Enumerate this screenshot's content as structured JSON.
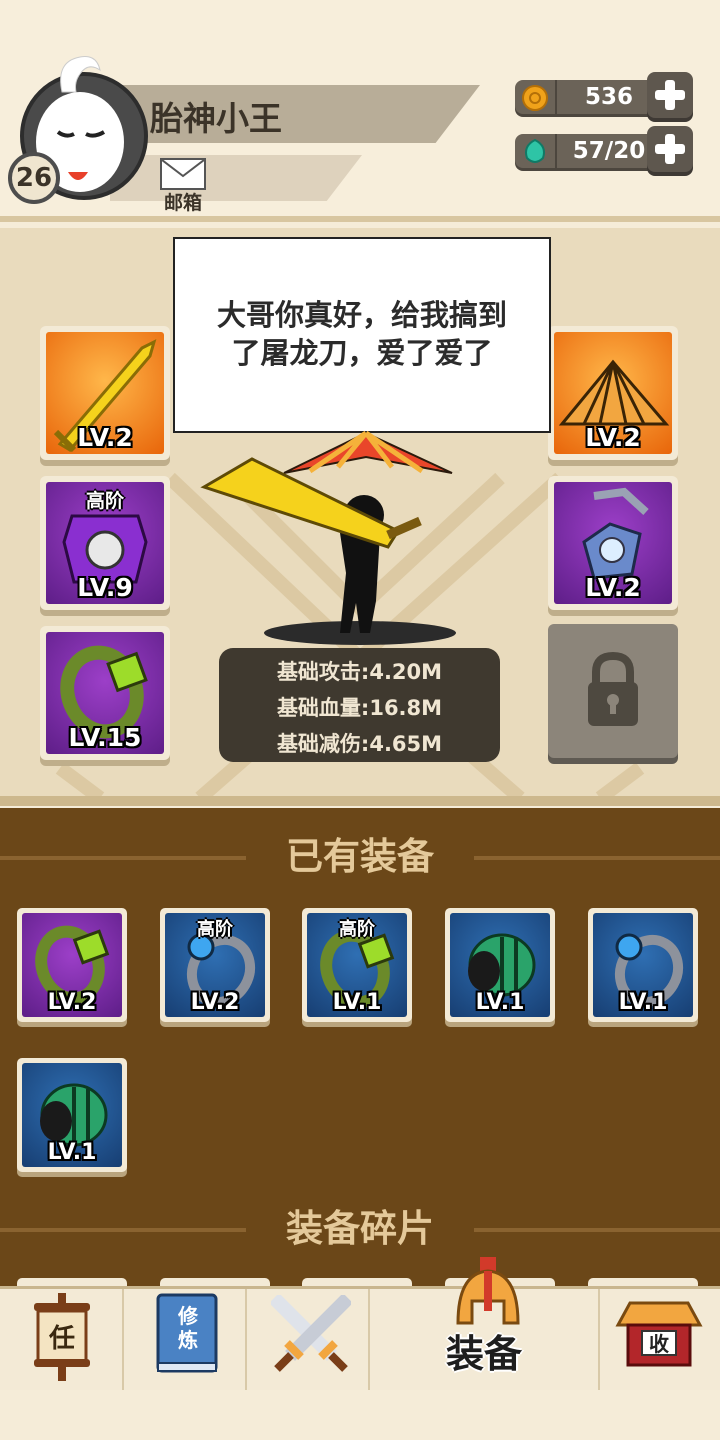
{
  "player": {
    "name": "胎神小王",
    "level": "26",
    "mail_label": "邮箱"
  },
  "resources": {
    "coins": {
      "value": "536",
      "icon": "coin-icon",
      "color": "#f0a21a"
    },
    "gems": {
      "value": "57/20",
      "icon": "gem-icon",
      "color": "#2ec4a6"
    }
  },
  "speech": {
    "text": "大哥你真好，给我搞到了屠龙刀，爱了爱了"
  },
  "equipped": {
    "left": [
      {
        "item": "sword-icon",
        "tier": "",
        "level": "LV.2",
        "bg": "orange"
      },
      {
        "item": "armor-icon",
        "tier": "高阶",
        "level": "LV.9",
        "bg": "purple"
      },
      {
        "item": "ring-icon",
        "tier": "",
        "level": "LV.15",
        "bg": "purple"
      }
    ],
    "right": [
      {
        "item": "hat-icon",
        "tier": "",
        "level": "LV.2",
        "bg": "orange"
      },
      {
        "item": "necklace-icon",
        "tier": "",
        "level": "LV.2",
        "bg": "purple"
      },
      {
        "item": "lock-icon",
        "tier": "",
        "level": "",
        "bg": "locked"
      }
    ]
  },
  "stats": {
    "attack": "基础攻击:4.20M",
    "hp": "基础血量:16.8M",
    "defense": "基础减伤:4.65M"
  },
  "inventory": {
    "title": "已有装备",
    "items": [
      {
        "item": "ring-icon",
        "tier": "",
        "level": "LV.2",
        "bg": "purple"
      },
      {
        "item": "silver-ring-icon",
        "tier": "高阶",
        "level": "LV.2",
        "bg": "blue"
      },
      {
        "item": "ring-icon",
        "tier": "高阶",
        "level": "LV.1",
        "bg": "blue"
      },
      {
        "item": "bracer-icon",
        "tier": "",
        "level": "LV.1",
        "bg": "blue"
      },
      {
        "item": "silver-ring-icon",
        "tier": "",
        "level": "LV.1",
        "bg": "blue"
      },
      {
        "item": "bracer-icon",
        "tier": "",
        "level": "LV.1",
        "bg": "blue"
      }
    ]
  },
  "fragments": {
    "title": "装备碎片"
  },
  "nav": {
    "tasks": {
      "glyph": "任"
    },
    "cultivate": {
      "glyph": "修炼"
    },
    "battle": {
      "glyph": ""
    },
    "equipment": {
      "label": "装备"
    },
    "collect": {
      "glyph": "收"
    }
  }
}
